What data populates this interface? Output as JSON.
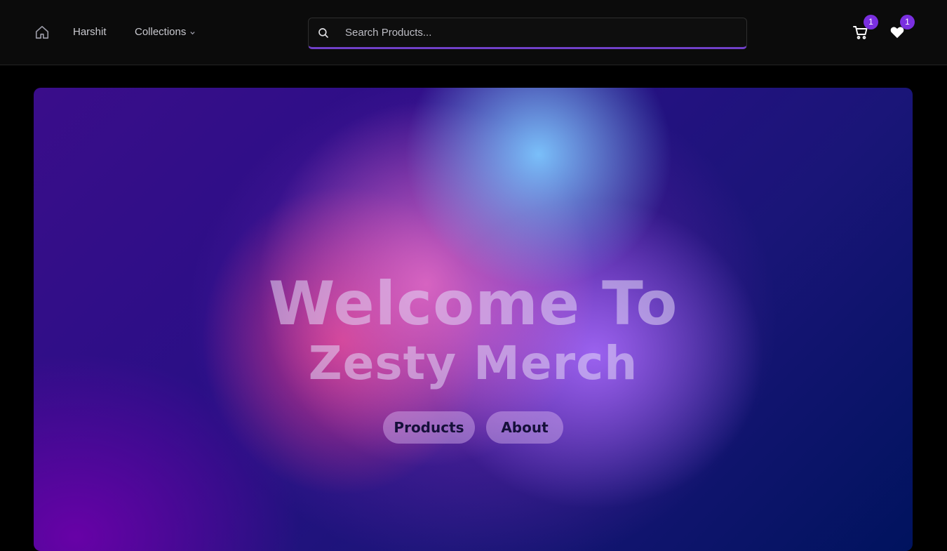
{
  "header": {
    "user_label": "Harshit",
    "collections_label": "Collections",
    "search": {
      "placeholder": "Search Products..."
    },
    "cart_count": "1",
    "wishlist_count": "1",
    "accent_color": "#7a2fe0"
  },
  "icons": {
    "home": "home-icon",
    "chevron": "chevron-down-icon",
    "search": "search-icon",
    "cart": "cart-icon",
    "wishlist": "heart-icon"
  },
  "hero": {
    "title_line1": "Welcome To",
    "title_line2": "Zesty Merch",
    "buttons": {
      "products": "Products",
      "about": "About"
    }
  }
}
